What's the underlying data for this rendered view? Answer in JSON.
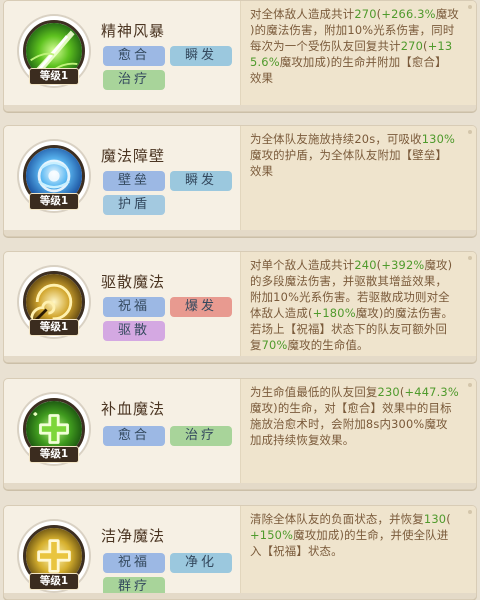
{
  "level_label": "等级1",
  "skills": [
    {
      "name": "精神风暴",
      "level": "等级1",
      "icon": "green-storm-icon",
      "tags": [
        {
          "label": "愈合",
          "color": "#9cb8e4"
        },
        {
          "label": "瞬发",
          "color": "#9bc8de"
        },
        {
          "label": "治疗",
          "color": "#a8d49a"
        }
      ],
      "description_lines": [
        [
          "对全体敌人造成共计",
          {
            "t": "270"
          },
          "(",
          {
            "t": "+266.3%"
          },
          "魔攻"
        ],
        [
          ")的魔法伤害，附加10%光系伤害，同时"
        ],
        [
          "每次为一个受伤队友回复共计",
          {
            "t": "270"
          },
          "(",
          {
            "t": "+13"
          }
        ],
        [
          {
            "t": "5.6%"
          },
          "魔攻加成)的生命并附加【愈合】"
        ],
        [
          "效果"
        ]
      ]
    },
    {
      "name": "魔法障壁",
      "level": "等级1",
      "icon": "blue-shield-orb-icon",
      "tags": [
        {
          "label": "壁垒",
          "color": "#9cb8e4"
        },
        {
          "label": "瞬发",
          "color": "#9bc8de"
        },
        {
          "label": "护盾",
          "color": "#a3c9e0"
        }
      ],
      "description_lines": [
        [
          "为全体队友施放持续20s，可吸收",
          {
            "t": "130%"
          }
        ],
        [
          "魔攻的护盾，为全体队友附加【壁垒】"
        ],
        [
          "效果"
        ]
      ]
    },
    {
      "name": "驱散魔法",
      "level": "等级1",
      "icon": "gold-swirl-icon",
      "tags": [
        {
          "label": "祝福",
          "color": "#9cb8e4"
        },
        {
          "label": "爆发",
          "color": "#e89a90"
        },
        {
          "label": "驱散",
          "color": "#d4a8e2"
        }
      ],
      "description_lines": [
        [
          "对单个敌人造成共计",
          {
            "t": "240"
          },
          "(",
          {
            "t": "+392%"
          },
          "魔攻)"
        ],
        [
          "的多段魔法伤害，并驱散其增益效果，"
        ],
        [
          "附加10%光系伤害。若驱散成功则对全"
        ],
        [
          "体敌人造成(",
          {
            "t": "+180%"
          },
          "魔攻)的魔法伤害。"
        ],
        [
          "若场上【祝福】状态下的队友可额外回"
        ],
        [
          "复",
          {
            "t": "70%"
          },
          "魔攻的生命值。"
        ]
      ]
    },
    {
      "name": "补血魔法",
      "level": "等级1",
      "icon": "green-cross-heal-icon",
      "tags": [
        {
          "label": "愈合",
          "color": "#9cb8e4"
        },
        {
          "label": "治疗",
          "color": "#a8d49a"
        }
      ],
      "description_lines": [
        [
          "为生命值最低的队友回复",
          {
            "t": "230"
          },
          "(",
          {
            "t": "+447.3%"
          }
        ],
        [
          "魔攻)的生命，对【愈合】效果中的目标"
        ],
        [
          "施放治愈术时，会附加8s内300%魔攻"
        ],
        [
          "加成持续恢复效果。"
        ]
      ]
    },
    {
      "name": "洁净魔法",
      "level": "等级1",
      "icon": "gold-cross-purify-icon",
      "tags": [
        {
          "label": "祝福",
          "color": "#9cb8e4"
        },
        {
          "label": "净化",
          "color": "#9bc8de"
        },
        {
          "label": "群疗",
          "color": "#a8d49a"
        }
      ],
      "description_lines": [
        [
          "清除全体队友的负面状态，并恢复",
          {
            "t": "130"
          },
          "("
        ],
        [
          {
            "t": "+150%"
          },
          "魔攻加成)的生命，并使全队进"
        ],
        [
          "入【祝福】状态。"
        ]
      ]
    }
  ]
}
